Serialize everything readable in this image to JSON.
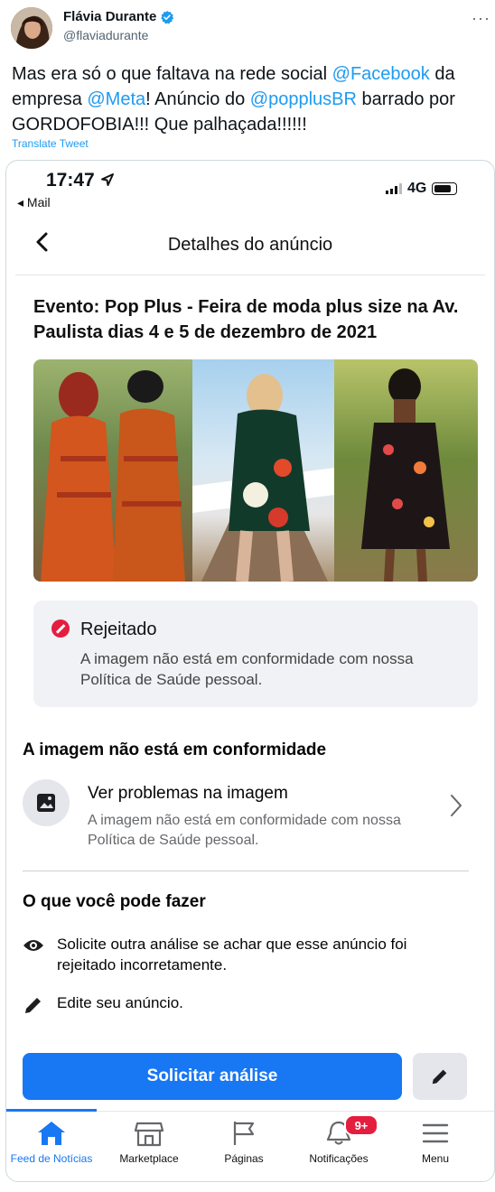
{
  "tweet": {
    "author_name": "Flávia Durante",
    "author_handle": "@flaviadurante",
    "more_label": "···",
    "text_parts": [
      "Mas era só o que faltava na rede social ",
      "@Facebook",
      " da empresa ",
      "@Meta",
      "! Anúncio do ",
      "@popplusBR",
      " barrado por GORDOFOBIA!!! Que palhaçada!!!!!!"
    ],
    "translate_label": "Translate Tweet"
  },
  "phone": {
    "status": {
      "time": "17:47",
      "back_app": "◂ Mail",
      "network": "4G"
    },
    "header": {
      "back_icon": "chevron-left-icon",
      "title": "Detalhes do anúncio"
    },
    "ad": {
      "title": "Evento: Pop Plus - Feira de moda plus size na Av. Paulista dias 4 e 5 de dezembro de 2021"
    },
    "rejection": {
      "status": "Rejeitado",
      "message": "A imagem não está em conformidade com nossa Política de Saúde pessoal.",
      "status_color": "#e41e3f"
    },
    "issue_section": {
      "title": "A imagem não está em conformidade",
      "item_title": "Ver problemas na imagem",
      "item_desc": "A imagem não está em conformidade com nossa Política de Saúde pessoal."
    },
    "actions_section": {
      "title": "O que você pode fazer",
      "action1": "Solicite outra análise se achar que esse anúncio foi rejeitado incorretamente.",
      "action2": "Edite seu anúncio."
    },
    "buttons": {
      "request_review": "Solicitar análise",
      "accent": "#1877f2"
    },
    "bottom_nav": {
      "items": [
        {
          "label": "Feed de Notícias",
          "icon": "home-icon"
        },
        {
          "label": "Marketplace",
          "icon": "store-icon"
        },
        {
          "label": "Páginas",
          "icon": "flag-icon"
        },
        {
          "label": "Notificações",
          "icon": "bell-icon"
        },
        {
          "label": "Menu",
          "icon": "hamburger-menu-icon"
        }
      ],
      "notifications_badge": "9+"
    }
  }
}
